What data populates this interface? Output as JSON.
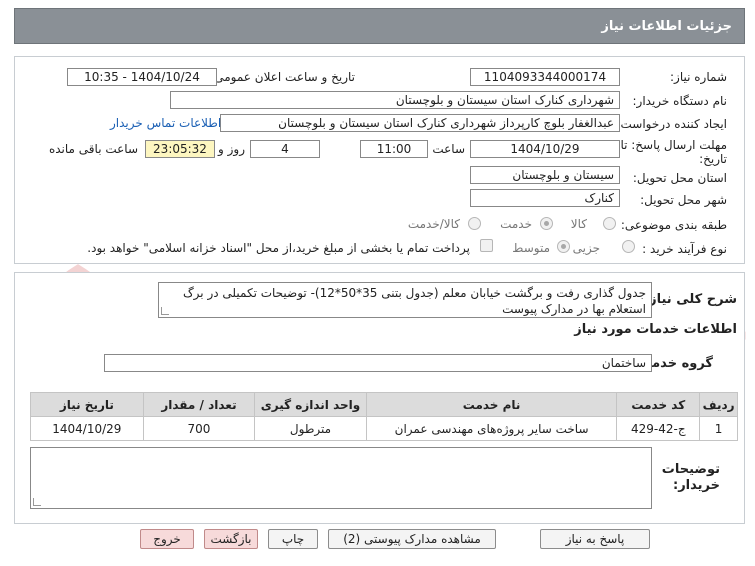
{
  "header": {
    "title": "جزئیات اطلاعات نیاز"
  },
  "form": {
    "need_number_label": "شماره نیاز:",
    "need_number": "1104093344000174",
    "announce_label": "تاریخ و ساعت اعلان عمومی:",
    "announce_value": "1404/10/24 - 10:35",
    "buyer_org_label": "نام دستگاه خریدار:",
    "buyer_org": "شهرداری کنارک استان سیستان و بلوچستان",
    "creator_label": "ایجاد کننده درخواست:",
    "creator": "عبدالغفار بلوچ کارپرداز شهرداری کنارک استان سیستان و بلوچستان",
    "contact_link": "اطلاعات تماس خریدار",
    "deadline_label_1": "مهلت ارسال پاسخ: تا",
    "deadline_label_2": "تاریخ:",
    "deadline_date": "1404/10/29",
    "time_label": "ساعت",
    "deadline_time": "11:00",
    "days_value": "4",
    "days_label": "روز و",
    "remaining_time": "23:05:32",
    "remaining_label": "ساعت باقی مانده",
    "province_label": "استان محل تحویل:",
    "province": "سیستان و بلوچستان",
    "city_label": "شهر محل تحویل:",
    "city": "کنارک",
    "category_label": "طبقه بندی موضوعی:",
    "category_options": [
      "کالا",
      "خدمت",
      "کالا/خدمت"
    ],
    "category_selected": "خدمت",
    "process_label": "نوع فرآیند خرید :",
    "process_options": [
      "جزیی",
      "متوسط"
    ],
    "process_selected": "متوسط",
    "payment_note": "پرداخت تمام یا بخشی از مبلغ خرید،از محل \"اسناد خزانه اسلامی\" خواهد بود."
  },
  "details": {
    "summary_label": "شرح کلی نیاز:",
    "summary": "جدول گذاری رفت و برگشت خیابان معلم (جدول بتنی 35*50*12)- توضیحات تکمیلی در برگ استعلام بها در مدارک پیوست",
    "services_title": "اطلاعات خدمات مورد نیاز",
    "service_group_label": "گروه خدمت:",
    "service_group": "ساختمان",
    "table": {
      "headers": [
        "ردیف",
        "کد خدمت",
        "نام خدمت",
        "واحد اندازه گیری",
        "تعداد / مقدار",
        "تاریخ نیاز"
      ],
      "rows": [
        [
          "1",
          "ج-42-429",
          "ساخت سایر پروژه‌های مهندسی عمران",
          "مترطول",
          "700",
          "1404/10/29"
        ]
      ]
    },
    "buyer_notes_label_1": "توضیحات",
    "buyer_notes_label_2": "خریدار:",
    "buyer_notes": ""
  },
  "buttons": {
    "reply": "پاسخ به نیاز",
    "attachments": "مشاهده مدارک پیوستی (2)",
    "print": "چاپ",
    "back": "بازگشت",
    "exit": "خروج"
  },
  "watermark": {
    "text": "AriaTender.net",
    "color": "#f0c8c8"
  }
}
